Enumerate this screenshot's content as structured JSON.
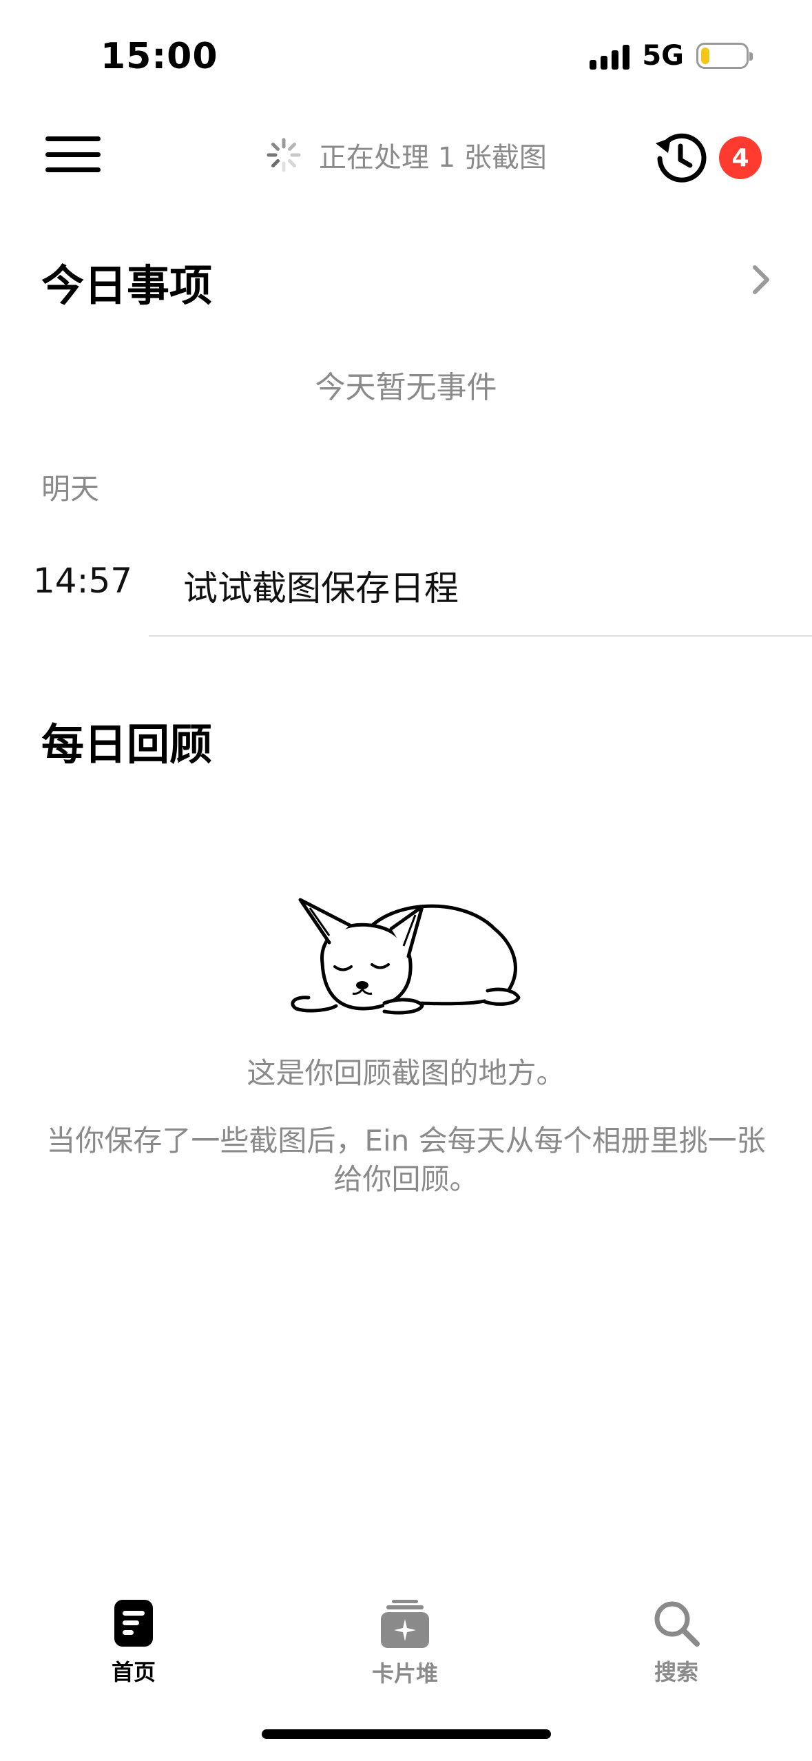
{
  "status_bar": {
    "time": "15:00",
    "network": "5G",
    "battery_level": 0.2
  },
  "nav": {
    "processing_text": "正在处理 1 张截图",
    "badge_count": "4"
  },
  "today": {
    "title": "今日事项",
    "empty_text": "今天暂无事件",
    "tomorrow_label": "明天",
    "events": [
      {
        "time": "14:57",
        "title": "试试截图保存日程"
      }
    ]
  },
  "review": {
    "title": "每日回顾",
    "line1": "这是你回顾截图的地方。",
    "line2": "当你保存了一些截图后，Ein 会每天从每个相册里挑一张给你回顾。"
  },
  "tabs": [
    {
      "label": "首页",
      "icon": "home-doc-icon",
      "active": true
    },
    {
      "label": "卡片堆",
      "icon": "card-stack-icon",
      "active": false
    },
    {
      "label": "搜索",
      "icon": "search-icon",
      "active": false
    }
  ],
  "colors": {
    "accent_active": "#000000",
    "inactive": "#8a8a8a",
    "badge": "#ff3b30",
    "battery": "#f5c518"
  }
}
